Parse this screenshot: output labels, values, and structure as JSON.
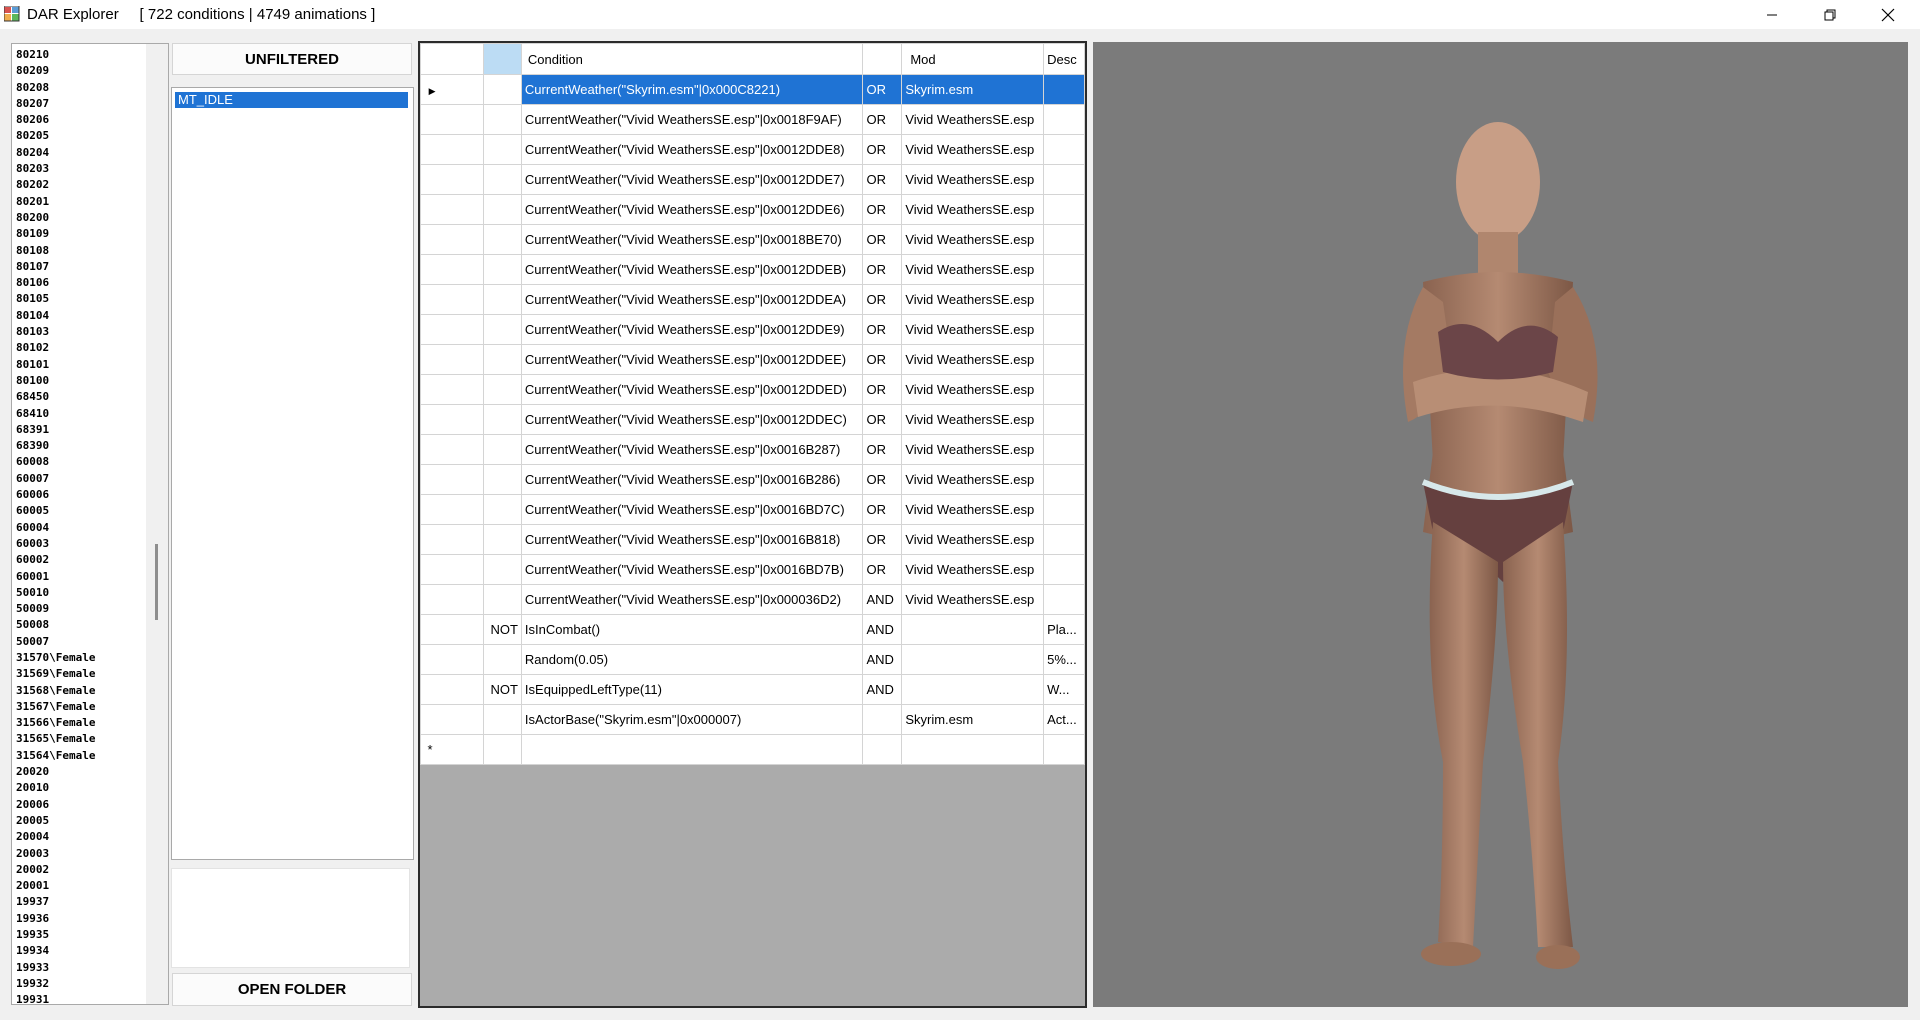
{
  "window": {
    "title": "DAR Explorer",
    "summary": "[ 722 conditions | 4749 animations ]",
    "controls": [
      "minimize",
      "restore",
      "close"
    ]
  },
  "id_list": [
    "80210",
    "80209",
    "80208",
    "80207",
    "80206",
    "80205",
    "80204",
    "80203",
    "80202",
    "80201",
    "80200",
    "80109",
    "80108",
    "80107",
    "80106",
    "80105",
    "80104",
    "80103",
    "80102",
    "80101",
    "80100",
    "68450",
    "68410",
    "68391",
    "68390",
    "60008",
    "60007",
    "60006",
    "60005",
    "60004",
    "60003",
    "60002",
    "60001",
    "50010",
    "50009",
    "50008",
    "50007",
    "31570\\Female",
    "31569\\Female",
    "31568\\Female",
    "31567\\Female",
    "31566\\Female",
    "31565\\Female",
    "31564\\Female",
    "20020",
    "20010",
    "20006",
    "20005",
    "20004",
    "20003",
    "20002",
    "20001",
    "19937",
    "19936",
    "19935",
    "19934",
    "19933",
    "19932",
    "19931"
  ],
  "filter_button": "UNFILTERED",
  "animation_list": [
    "MT_IDLE"
  ],
  "open_folder_button": "OPEN FOLDER",
  "grid": {
    "columns": [
      "",
      "Condition",
      "",
      "Mod",
      "Desc"
    ],
    "rows": [
      {
        "negate": "",
        "condition": "CurrentWeather(\"Skyrim.esm\"|0x000C8221)",
        "op": "OR",
        "mod": "Skyrim.esm",
        "desc": ""
      },
      {
        "negate": "",
        "condition": "CurrentWeather(\"Vivid WeathersSE.esp\"|0x0018F9AF)",
        "op": "OR",
        "mod": "Vivid WeathersSE.esp",
        "desc": ""
      },
      {
        "negate": "",
        "condition": "CurrentWeather(\"Vivid WeathersSE.esp\"|0x0012DDE8)",
        "op": "OR",
        "mod": "Vivid WeathersSE.esp",
        "desc": ""
      },
      {
        "negate": "",
        "condition": "CurrentWeather(\"Vivid WeathersSE.esp\"|0x0012DDE7)",
        "op": "OR",
        "mod": "Vivid WeathersSE.esp",
        "desc": ""
      },
      {
        "negate": "",
        "condition": "CurrentWeather(\"Vivid WeathersSE.esp\"|0x0012DDE6)",
        "op": "OR",
        "mod": "Vivid WeathersSE.esp",
        "desc": ""
      },
      {
        "negate": "",
        "condition": "CurrentWeather(\"Vivid WeathersSE.esp\"|0x0018BE70)",
        "op": "OR",
        "mod": "Vivid WeathersSE.esp",
        "desc": ""
      },
      {
        "negate": "",
        "condition": "CurrentWeather(\"Vivid WeathersSE.esp\"|0x0012DDEB)",
        "op": "OR",
        "mod": "Vivid WeathersSE.esp",
        "desc": ""
      },
      {
        "negate": "",
        "condition": "CurrentWeather(\"Vivid WeathersSE.esp\"|0x0012DDEA)",
        "op": "OR",
        "mod": "Vivid WeathersSE.esp",
        "desc": ""
      },
      {
        "negate": "",
        "condition": "CurrentWeather(\"Vivid WeathersSE.esp\"|0x0012DDE9)",
        "op": "OR",
        "mod": "Vivid WeathersSE.esp",
        "desc": ""
      },
      {
        "negate": "",
        "condition": "CurrentWeather(\"Vivid WeathersSE.esp\"|0x0012DDEE)",
        "op": "OR",
        "mod": "Vivid WeathersSE.esp",
        "desc": ""
      },
      {
        "negate": "",
        "condition": "CurrentWeather(\"Vivid WeathersSE.esp\"|0x0012DDED)",
        "op": "OR",
        "mod": "Vivid WeathersSE.esp",
        "desc": ""
      },
      {
        "negate": "",
        "condition": "CurrentWeather(\"Vivid WeathersSE.esp\"|0x0012DDEC)",
        "op": "OR",
        "mod": "Vivid WeathersSE.esp",
        "desc": ""
      },
      {
        "negate": "",
        "condition": "CurrentWeather(\"Vivid WeathersSE.esp\"|0x0016B287)",
        "op": "OR",
        "mod": "Vivid WeathersSE.esp",
        "desc": ""
      },
      {
        "negate": "",
        "condition": "CurrentWeather(\"Vivid WeathersSE.esp\"|0x0016B286)",
        "op": "OR",
        "mod": "Vivid WeathersSE.esp",
        "desc": ""
      },
      {
        "negate": "",
        "condition": "CurrentWeather(\"Vivid WeathersSE.esp\"|0x0016BD7C)",
        "op": "OR",
        "mod": "Vivid WeathersSE.esp",
        "desc": ""
      },
      {
        "negate": "",
        "condition": "CurrentWeather(\"Vivid WeathersSE.esp\"|0x0016B818)",
        "op": "OR",
        "mod": "Vivid WeathersSE.esp",
        "desc": ""
      },
      {
        "negate": "",
        "condition": "CurrentWeather(\"Vivid WeathersSE.esp\"|0x0016BD7B)",
        "op": "OR",
        "mod": "Vivid WeathersSE.esp",
        "desc": ""
      },
      {
        "negate": "",
        "condition": "CurrentWeather(\"Vivid WeathersSE.esp\"|0x000036D2)",
        "op": "AND",
        "mod": "Vivid WeathersSE.esp",
        "desc": ""
      },
      {
        "negate": "NOT",
        "condition": "IsInCombat()",
        "op": "AND",
        "mod": "",
        "desc": "Pla..."
      },
      {
        "negate": "",
        "condition": "Random(0.05)",
        "op": "AND",
        "mod": "",
        "desc": "5%..."
      },
      {
        "negate": "NOT",
        "condition": "IsEquippedLeftType(11)",
        "op": "AND",
        "mod": "",
        "desc": "W..."
      },
      {
        "negate": "",
        "condition": "IsActorBase(\"Skyrim.esm\"|0x000007)",
        "op": "",
        "mod": "Skyrim.esm",
        "desc": "Act..."
      }
    ],
    "selected_row": 0,
    "current_row_marker": "▶",
    "new_row_marker": "*"
  },
  "colors": {
    "selection": "#1f73d4",
    "preview_background": "#7b7b7b"
  }
}
